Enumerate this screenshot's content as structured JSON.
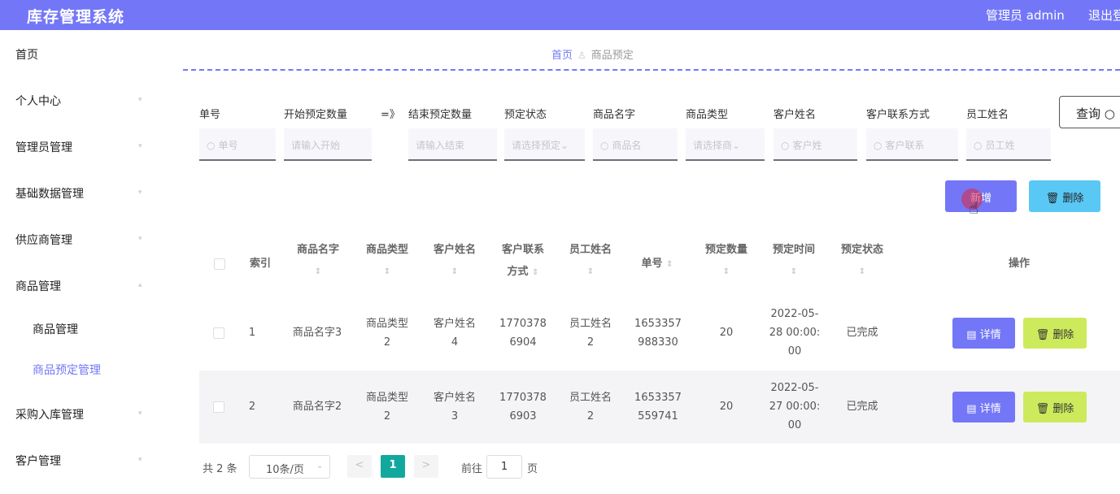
{
  "header": {
    "title": "库存管理系统",
    "user": "管理员 admin",
    "logout": "退出登录"
  },
  "sidebar": {
    "items": [
      {
        "label": "首页"
      },
      {
        "label": "个人中心"
      },
      {
        "label": "管理员管理"
      },
      {
        "label": "基础数据管理"
      },
      {
        "label": "供应商管理"
      },
      {
        "label": "商品管理"
      },
      {
        "label": "采购入库管理"
      },
      {
        "label": "客户管理"
      }
    ],
    "sub_items": [
      {
        "label": "商品管理",
        "active": false
      },
      {
        "label": "商品预定管理",
        "active": true
      }
    ]
  },
  "breadcrumb": {
    "home": "首页",
    "current": "商品预定"
  },
  "filters": {
    "labels": {
      "order_no": "单号",
      "qty_start": "开始预定数量",
      "range_sep": "=》",
      "qty_end": "结束预定数量",
      "status": "预定状态",
      "product_name": "商品名字",
      "product_type": "商品类型",
      "customer_name": "客户姓名",
      "customer_contact": "客户联系方式",
      "staff_name": "员工姓名"
    },
    "placeholders": {
      "order_no": "单号",
      "qty_start": "请输入开始",
      "qty_end": "请输入结束",
      "status": "请选择预定",
      "product_name": "商品名",
      "product_type": "请选择商",
      "customer_name": "客户姓",
      "customer_contact": "客户联系",
      "staff_name": "员工姓"
    },
    "query_label": "查询"
  },
  "actions": {
    "add": "新增",
    "delete": "删除"
  },
  "table": {
    "headers": {
      "index": "索引",
      "product_name": "商品名字",
      "product_type": "商品类型",
      "customer_name": "客户姓名",
      "customer_contact_1": "客户联系",
      "customer_contact_2": "方式",
      "staff_name": "员工姓名",
      "order_no": "单号",
      "qty": "预定数量",
      "time": "预定时间",
      "status": "预定状态",
      "ops": "操作"
    },
    "rows": [
      {
        "index": "1",
        "product_name": "商品名字3",
        "product_type_1": "商品类型",
        "product_type_2": "2",
        "customer_name_1": "客户姓名",
        "customer_name_2": "4",
        "contact_1": "1770378",
        "contact_2": "6904",
        "staff_1": "员工姓名",
        "staff_2": "2",
        "order_1": "1653357",
        "order_2": "988330",
        "qty": "20",
        "time_1": "2022-05-",
        "time_2": "28 00:00:",
        "time_3": "00",
        "status": "已完成"
      },
      {
        "index": "2",
        "product_name": "商品名字2",
        "product_type_1": "商品类型",
        "product_type_2": "2",
        "customer_name_1": "客户姓名",
        "customer_name_2": "3",
        "contact_1": "1770378",
        "contact_2": "6903",
        "staff_1": "员工姓名",
        "staff_2": "2",
        "order_1": "1653357",
        "order_2": "559741",
        "qty": "20",
        "time_1": "2022-05-",
        "time_2": "27 00:00:",
        "time_3": "00",
        "status": "已完成"
      }
    ],
    "row_detail": "详情",
    "row_delete": "删除"
  },
  "pager": {
    "total": "共 2 条",
    "size": "10条/页",
    "prev": "<",
    "current": "1",
    "next": ">",
    "goto": "前往",
    "goto_value": "1",
    "page_unit": "页"
  },
  "colors": {
    "accent": "#7377f7",
    "delete_top": "#5ac8f5",
    "delete_row": "#cdea5c",
    "pager_active": "#13a89e"
  }
}
